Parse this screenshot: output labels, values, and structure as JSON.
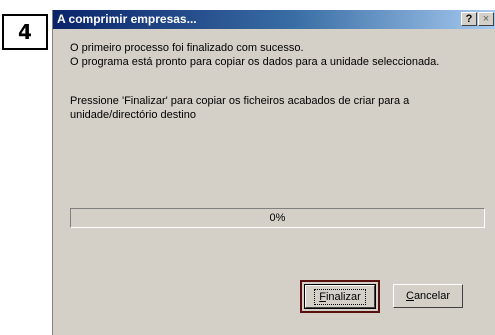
{
  "step_badge": "4",
  "window": {
    "title": "A comprimir empresas...",
    "help_glyph": "?",
    "close_glyph": "×"
  },
  "messages": {
    "line1": "O primeiro processo foi finalizado com sucesso.",
    "line2": "O programa está pronto para copiar os dados para a unidade seleccionada.",
    "line3": "Pressione 'Finalizar' para copiar os ficheiros acabados de criar para a",
    "line4": "unidade/directório destino"
  },
  "progress": {
    "text": "0%",
    "value": 0
  },
  "buttons": {
    "finalize_first": "F",
    "finalize_rest": "inalizar",
    "cancel_first": "C",
    "cancel_rest": "ancelar"
  },
  "colors": {
    "titlebar_start": "#0a246a",
    "dialog_bg": "#d4d0c8",
    "highlight_border": "#5a0f0f"
  }
}
